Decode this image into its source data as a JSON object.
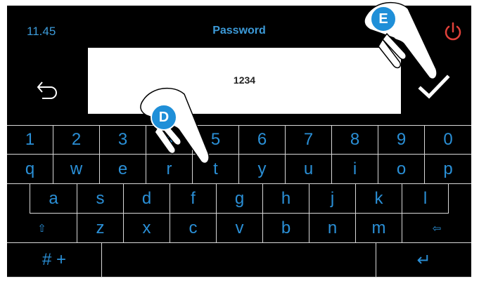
{
  "header": {
    "time": "11.45",
    "title": "Password"
  },
  "password_field": {
    "value": "1234"
  },
  "icons": {
    "power": "power-icon",
    "back": "back-arrow-icon",
    "confirm": "checkmark-icon"
  },
  "keyboard": {
    "row1": [
      "1",
      "2",
      "3",
      "4",
      "5",
      "6",
      "7",
      "8",
      "9",
      "0"
    ],
    "row2": [
      "q",
      "w",
      "e",
      "r",
      "t",
      "y",
      "u",
      "i",
      "o",
      "p"
    ],
    "row3": [
      "a",
      "s",
      "d",
      "f",
      "g",
      "h",
      "j",
      "k",
      "l"
    ],
    "row4": [
      "⇧",
      "z",
      "x",
      "c",
      "v",
      "b",
      "n",
      "m",
      "⇦"
    ],
    "row5": {
      "symbols": "# +",
      "space": "",
      "enter": "↵"
    }
  },
  "callouts": {
    "d": "D",
    "e": "E"
  },
  "colors": {
    "accent": "#2a8fd6",
    "background": "#000000",
    "power": "#e0413a"
  }
}
